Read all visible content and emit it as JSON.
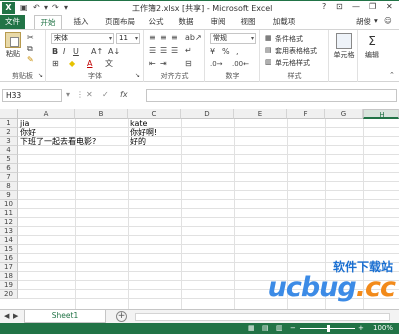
{
  "titlebar": {
    "app_icon": "X",
    "title": "工作簿2.xlsx [共享] - Microsoft Excel",
    "help": "?",
    "minimize": "—",
    "restore": "❐",
    "close": "✕"
  },
  "tabs": {
    "file": "文件",
    "items": [
      "开始",
      "插入",
      "页面布局",
      "公式",
      "数据",
      "审阅",
      "视图",
      "加载项"
    ],
    "user": "胡俊"
  },
  "ribbon": {
    "paste": "粘贴",
    "clipboard": "剪贴板",
    "font_name": "宋体",
    "font_size": "11",
    "font": "字体",
    "alignment": "对齐方式",
    "number_format": "常规",
    "number": "数字",
    "cond_format": "条件格式",
    "table_format": "套用表格格式",
    "cell_styles": "单元格样式",
    "styles": "样式",
    "cells": "单元格",
    "editing": "编辑",
    "percent": "%",
    "comma": ",",
    "bold": "B",
    "italic": "I",
    "underline": "U",
    "font_color_letter": "A"
  },
  "formula_bar": {
    "name_box": "H33",
    "cancel": "✕",
    "enter": "✓",
    "fx": "fx",
    "value": ""
  },
  "grid": {
    "columns": [
      "A",
      "B",
      "C",
      "D",
      "E",
      "F",
      "G",
      "H"
    ],
    "selected_column": "H",
    "rows": [
      "1",
      "2",
      "3",
      "4",
      "5",
      "6",
      "7",
      "8",
      "9",
      "10",
      "11",
      "12",
      "13",
      "14",
      "15",
      "16",
      "17",
      "18",
      "19",
      "20"
    ],
    "cells": {
      "A1": "jia",
      "C1": "kate",
      "A2": "你好",
      "C2": "你好啊!",
      "A3": "下班了一起去看电影?",
      "C3": "好的"
    }
  },
  "sheets": {
    "active": "Sheet1",
    "add": "+"
  },
  "status": {
    "zoom": "100%"
  },
  "watermark": {
    "text": "软件下载站",
    "logo_main": "ucbug",
    "logo_suffix": ".cc"
  }
}
